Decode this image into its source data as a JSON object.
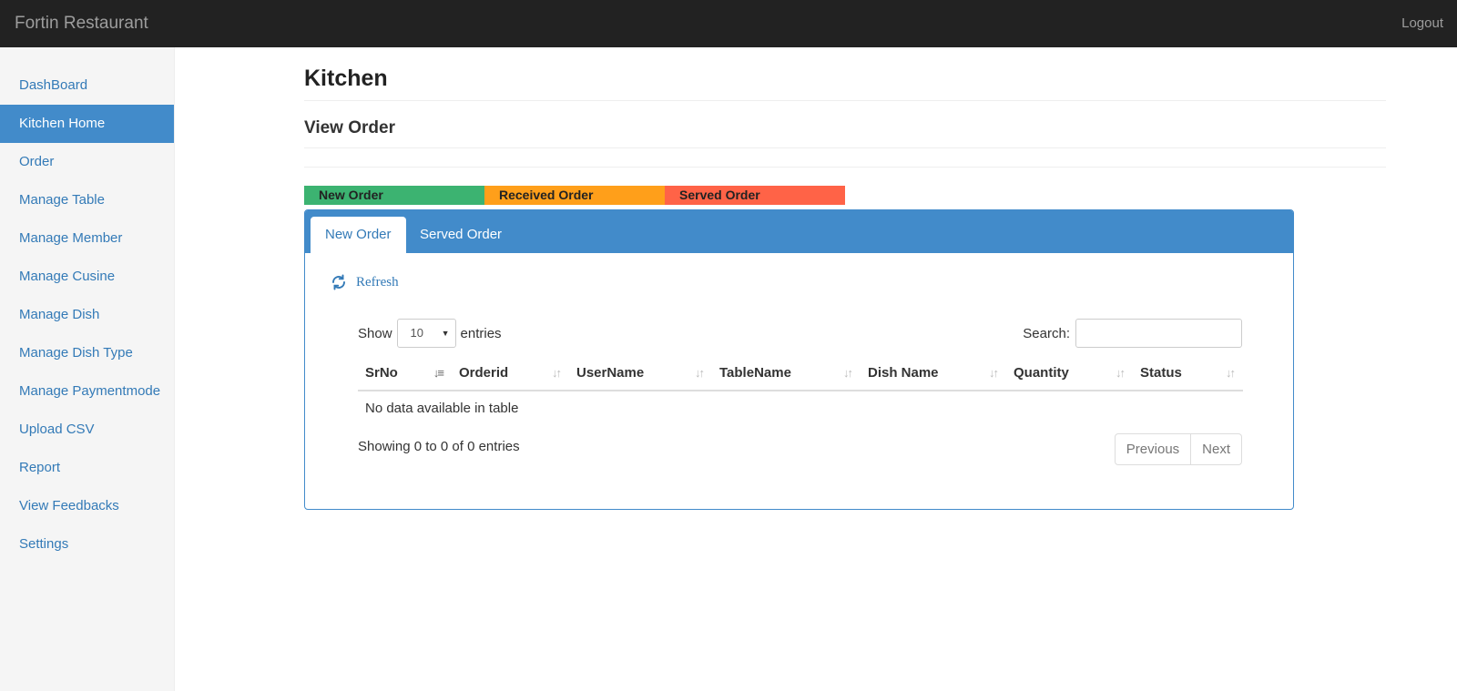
{
  "navbar": {
    "brand": "Fortin Restaurant",
    "logout": "Logout"
  },
  "sidebar": {
    "items": [
      {
        "label": "DashBoard",
        "active": false
      },
      {
        "label": "Kitchen Home",
        "active": true
      },
      {
        "label": "Order",
        "active": false
      },
      {
        "label": "Manage Table",
        "active": false
      },
      {
        "label": "Manage Member",
        "active": false
      },
      {
        "label": "Manage Cusine",
        "active": false
      },
      {
        "label": "Manage Dish",
        "active": false
      },
      {
        "label": "Manage Dish Type",
        "active": false
      },
      {
        "label": "Manage Paymentmode",
        "active": false
      },
      {
        "label": "Upload CSV",
        "active": false
      },
      {
        "label": "Report",
        "active": false
      },
      {
        "label": "View Feedbacks",
        "active": false
      },
      {
        "label": "Settings",
        "active": false
      }
    ]
  },
  "page": {
    "title": "Kitchen",
    "subtitle": "View Order"
  },
  "legend": [
    {
      "label": "New Order",
      "color": "#3cb371"
    },
    {
      "label": "Received Order",
      "color": "#ff9f1a"
    },
    {
      "label": "Served Order",
      "color": "#ff6347"
    }
  ],
  "tabs": {
    "new_order": "New Order",
    "served_order": "Served Order"
  },
  "refresh": {
    "label": "Refresh",
    "icon": "refresh-icon"
  },
  "table_controls": {
    "show_label": "Show",
    "page_size": "10",
    "entries_label": "entries",
    "search_label": "Search:",
    "search_value": ""
  },
  "table": {
    "columns": [
      "SrNo",
      "Orderid",
      "UserName",
      "TableName",
      "Dish Name",
      "Quantity",
      "Status"
    ],
    "sorted_column": "SrNo",
    "empty_message": "No data available in table",
    "info": "Showing 0 to 0 of 0 entries"
  },
  "pagination": {
    "previous": "Previous",
    "next": "Next"
  },
  "colors": {
    "accent": "#428bca",
    "link": "#337ab7",
    "navbar": "#222222"
  }
}
